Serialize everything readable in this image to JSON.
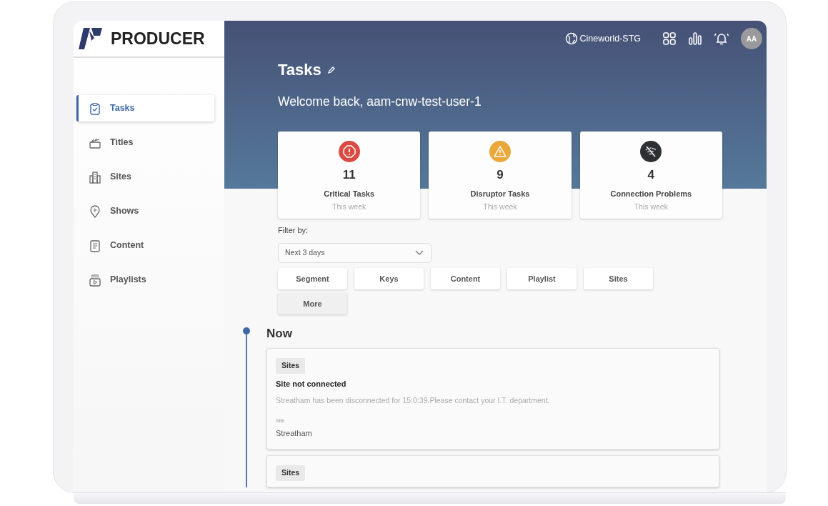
{
  "app": {
    "name": "PRODUCER"
  },
  "sidebar": {
    "items": [
      {
        "label": "Tasks",
        "selected": true
      },
      {
        "label": "Titles",
        "selected": false
      },
      {
        "label": "Sites",
        "selected": false
      },
      {
        "label": "Shows",
        "selected": false
      },
      {
        "label": "Content",
        "selected": false
      },
      {
        "label": "Playlists",
        "selected": false
      }
    ]
  },
  "topbar": {
    "workspace": "Cineworld-STG",
    "avatar": "AA"
  },
  "page": {
    "title": "Tasks",
    "welcome": "Welcome back, aam-cnw-test-user-1"
  },
  "stats": [
    {
      "kind": "critical",
      "color": "#dc4b43",
      "value": "11",
      "label": "Critical Tasks",
      "period": "This week"
    },
    {
      "kind": "warning",
      "color": "#eaa73a",
      "value": "9",
      "label": "Disruptor Tasks",
      "period": "This week"
    },
    {
      "kind": "offline",
      "color": "#2d2f33",
      "value": "4",
      "label": "Connection Problems",
      "period": "This week"
    }
  ],
  "filter": {
    "label": "Filter by:",
    "range": "Next 3 days",
    "chips": [
      "Segment",
      "Keys",
      "Content",
      "Playlist",
      "Sites"
    ],
    "more": "More"
  },
  "timeline": {
    "heading": "Now",
    "tasks": [
      {
        "tag": "Sites",
        "title": "Site not connected",
        "message": "Streatham has been disconnected for 15:0:39.Please contact your I.T. department.",
        "field_label": "Site",
        "field_value": "Streatham"
      },
      {
        "tag": "Sites"
      }
    ]
  }
}
